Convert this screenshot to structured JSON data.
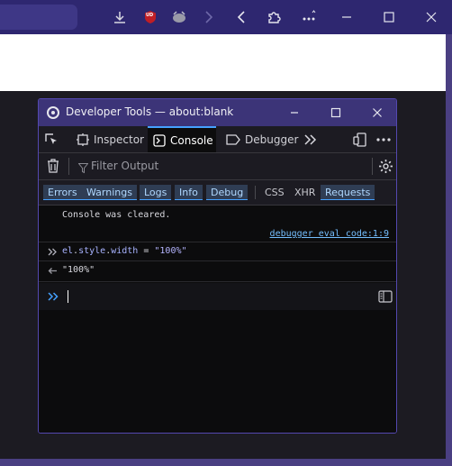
{
  "browser": {
    "toolbar": {
      "icons": [
        "download-icon",
        "ublock-icon",
        "extension-icon",
        "forward-chevron-icon",
        "back-chevron-icon",
        "extensions-puzzle-icon",
        "more-icon"
      ],
      "window_controls": [
        "minimize-icon",
        "maximize-icon",
        "close-icon"
      ],
      "ublock_badge": "UD"
    }
  },
  "devtools": {
    "title": "Developer Tools — about:blank",
    "tabs": [
      {
        "label": "Inspector",
        "icon": "inspector-icon"
      },
      {
        "label": "Console",
        "icon": "console-icon",
        "active": true
      },
      {
        "label": "Debugger",
        "icon": "debugger-icon"
      }
    ],
    "filter": {
      "placeholder": "Filter Output"
    },
    "levels": [
      {
        "label": "Errors",
        "active": true
      },
      {
        "label": "Warnings",
        "active": true
      },
      {
        "label": "Logs",
        "active": true
      },
      {
        "label": "Info",
        "active": true
      },
      {
        "label": "Debug",
        "active": true
      },
      {
        "label": "CSS",
        "active": false
      },
      {
        "label": "XHR",
        "active": false
      },
      {
        "label": "Requests",
        "active": true
      }
    ],
    "console": {
      "cleared_message": "Console was cleared.",
      "cleared_source": "debugger eval code:1:9",
      "input_obj": "el",
      "input_dot1": ".",
      "input_prop1": "style",
      "input_dot2": ".",
      "input_prop2": "width",
      "input_op": " = ",
      "input_value": "\"100%\"",
      "output_value": "\"100%\"",
      "prompt_value": ""
    },
    "colors": {
      "accent": "#45a1ff",
      "titlebar": "#3c3478",
      "border": "#5448b0"
    }
  }
}
